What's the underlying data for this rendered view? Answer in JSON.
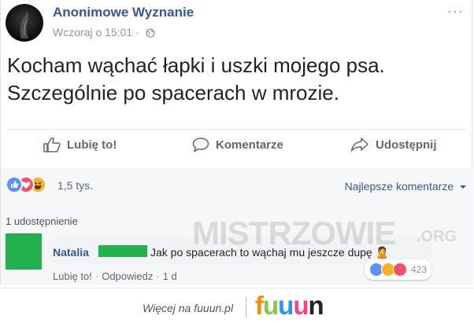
{
  "post": {
    "page_name": "Anonimowe Wyznanie",
    "timestamp": "Wczoraj o 15:01",
    "meta_dot": "·",
    "lines": [
      "Kocham wąchać łapki i uszki mojego psa.",
      "Szczególnie po spacerach w mrozie."
    ]
  },
  "actions": {
    "like": "Lubię to!",
    "comment": "Komentarze",
    "share": "Udostępnij"
  },
  "reactions": {
    "count": "1,5 tys.",
    "sort_label": "Najlepsze komentarze",
    "types": [
      "like",
      "love",
      "haha"
    ]
  },
  "shares": {
    "label": "1 udostępnienie"
  },
  "comment": {
    "author": "Natalia",
    "text": "Jak po spacerach to wąchaj mu jeszcze dupę",
    "emoji": "🙎",
    "like_link": "Lubię to!",
    "reply_link": "Odpowiedz",
    "age": "1 d",
    "reaction_count": "423",
    "reaction_types": [
      "like",
      "haha",
      "love"
    ]
  },
  "watermark": {
    "text": "MISTRZOWIE",
    "suffix": ".ORG"
  },
  "footer": {
    "more_text": "Więcej na fuuun.pl",
    "logo_letters": [
      "f",
      "u",
      "u",
      "u",
      "n"
    ],
    "logo_colors": [
      "#ff8a00",
      "#8bc34a",
      "#2196f3",
      "#ff3d8b",
      "#222222"
    ]
  },
  "colors": {
    "link_blue": "#365899",
    "redact_green": "#22b14c",
    "like_blue": "#5890ff",
    "love_red": "#f25268",
    "haha_yellow": "#f7b125"
  }
}
